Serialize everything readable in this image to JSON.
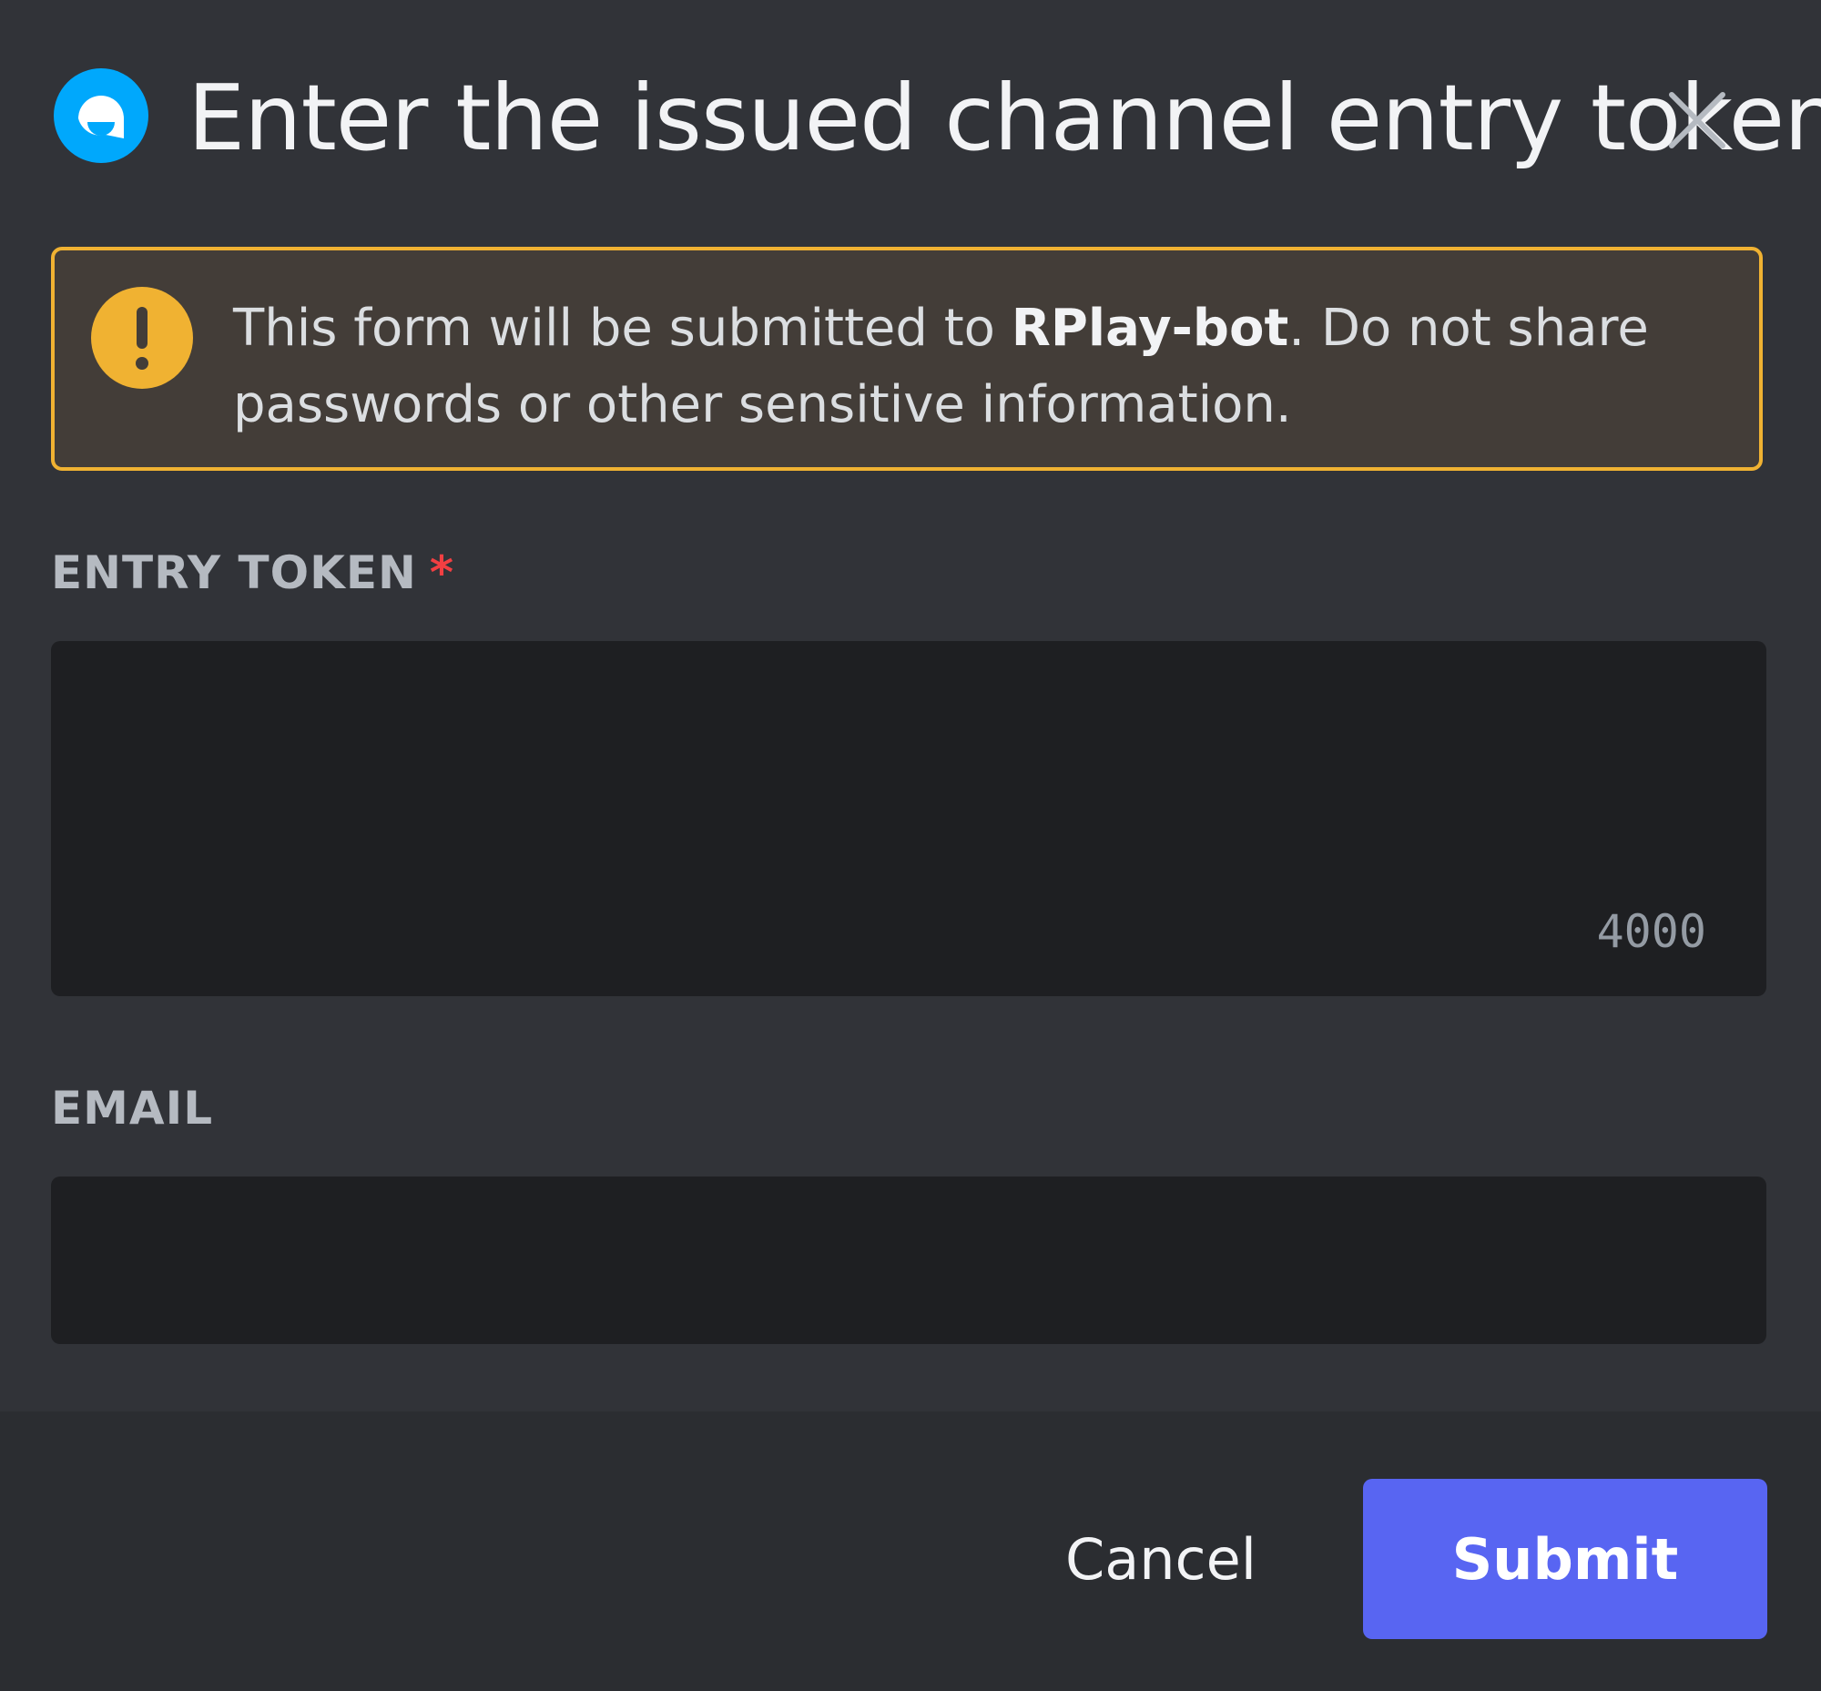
{
  "modal": {
    "title": "Enter the issued channel entry token",
    "bot_icon": "chat-bubble-icon",
    "close_icon": "close-icon"
  },
  "warning": {
    "icon": "exclamation-icon",
    "text_before": "This form will be submitted to ",
    "bot_name": "RPlay-bot",
    "text_after": ". Do not share passwords or other sensitive information."
  },
  "fields": {
    "entry_token": {
      "label": "ENTRY TOKEN",
      "required_mark": "*",
      "value": "",
      "char_limit": "4000"
    },
    "email": {
      "label": "EMAIL",
      "value": ""
    }
  },
  "footer": {
    "cancel_label": "Cancel",
    "submit_label": "Submit"
  },
  "colors": {
    "accent": "#5865f2",
    "warning": "#f0b232",
    "bot_icon": "#00a8fc",
    "required": "#f23f42"
  }
}
